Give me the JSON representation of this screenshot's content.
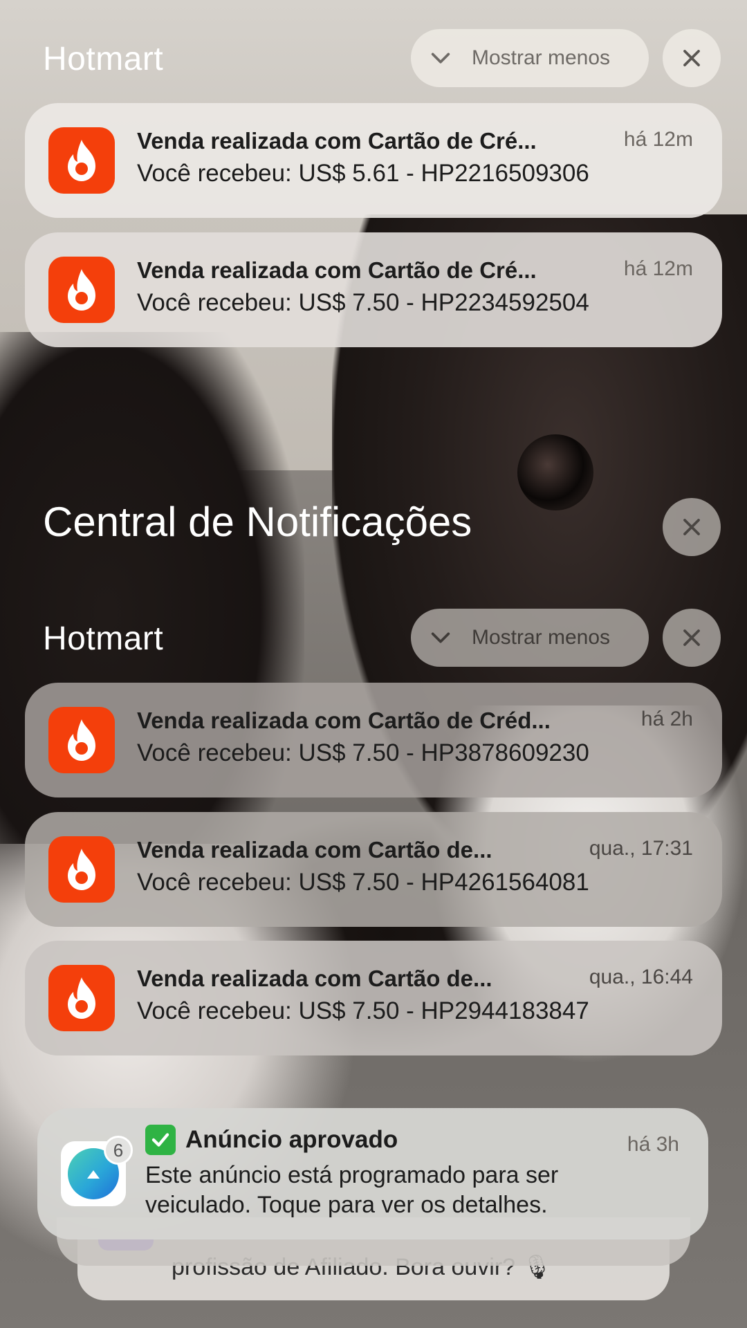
{
  "top_group": {
    "app_name": "Hotmart",
    "show_less_label": "Mostrar menos",
    "notifications": [
      {
        "title": "Venda realizada com Cartão de Cré...",
        "body": "Você recebeu: US$ 5.61 - HP2216509306",
        "time": "há 12m"
      },
      {
        "title": "Venda realizada com Cartão de Cré...",
        "body": "Você recebeu: US$ 7.50 - HP2234592504",
        "time": "há 12m"
      }
    ]
  },
  "notification_center": {
    "title": "Central de Notificações"
  },
  "second_group": {
    "app_name": "Hotmart",
    "show_less_label": "Mostrar menos",
    "notifications": [
      {
        "title": "Venda realizada com Cartão de Créd...",
        "body": "Você recebeu: US$ 7.50 - HP3878609230",
        "time": "há 2h"
      },
      {
        "title": "Venda realizada com Cartão de...",
        "body": "Você recebeu: US$ 7.50 - HP4261564081",
        "time": "qua., 17:31"
      },
      {
        "title": "Venda realizada com Cartão de...",
        "body": "Você recebeu: US$ 7.50 - HP2944183847",
        "time": "qua., 16:44"
      }
    ]
  },
  "ad_notification": {
    "badge_count": "6",
    "title": "Anúncio aprovado",
    "body": "Este anúncio está programado para ser veiculado. Toque para ver os detalhes.",
    "time": "há 3h"
  },
  "stacked_notification": {
    "body_peek": "profissão de Afiliado. Bora ouvir? 🎙"
  },
  "colors": {
    "hotmart_orange": "#f43f0b",
    "check_green": "#2fb344"
  }
}
